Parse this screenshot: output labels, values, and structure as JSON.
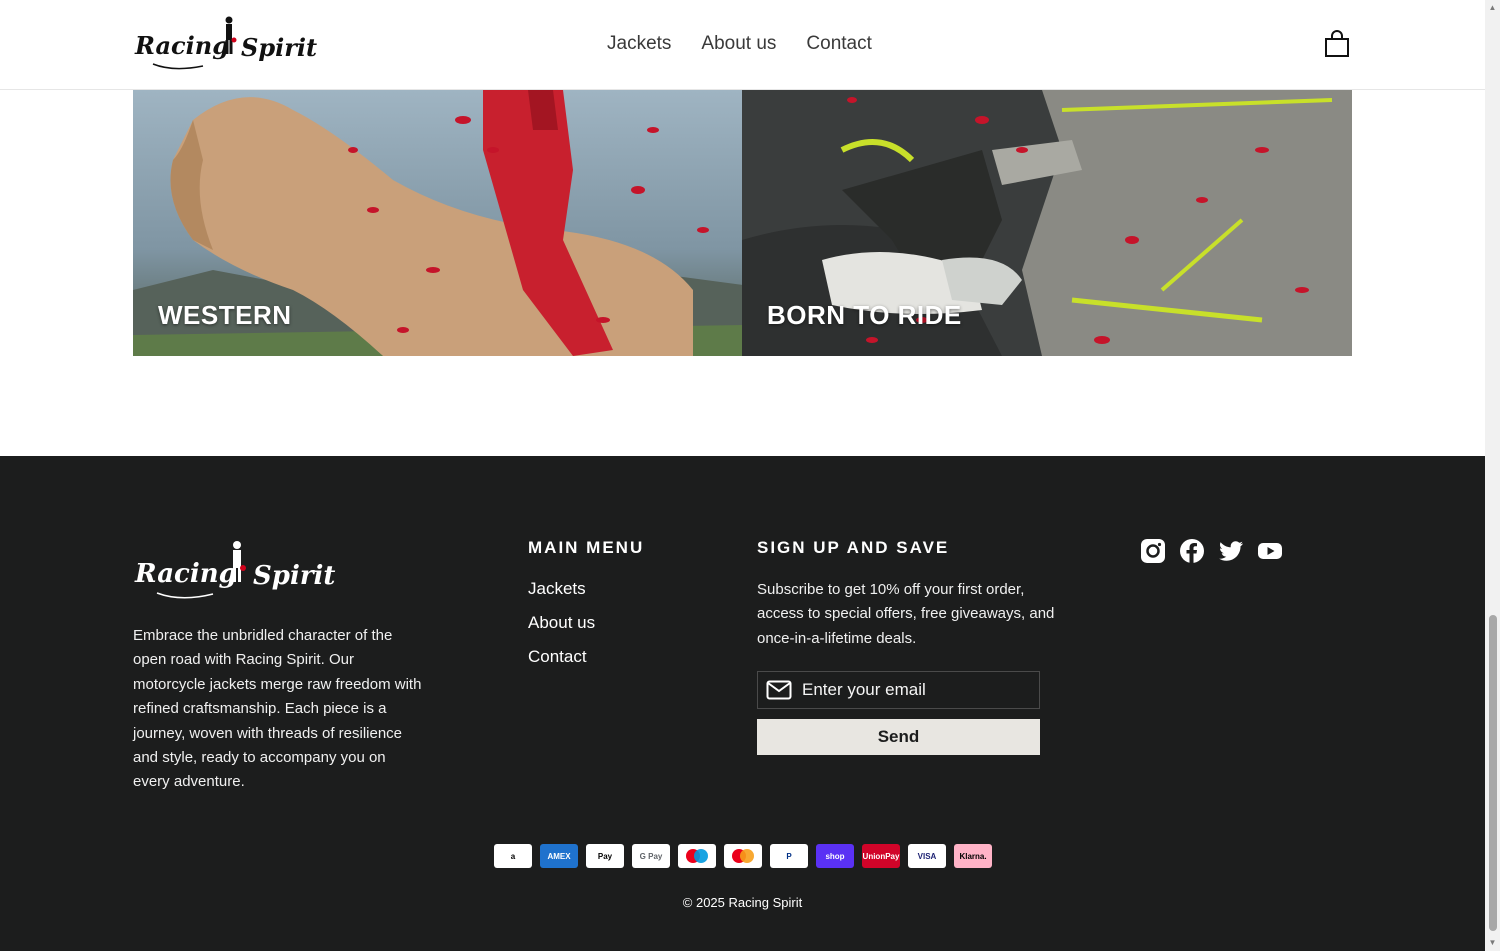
{
  "header": {
    "logo_alt": "Racing Spirit",
    "nav": [
      "Jackets",
      "About us",
      "Contact"
    ],
    "cart_icon": "shopping-bag-icon"
  },
  "collections": [
    {
      "title": "WESTERN"
    },
    {
      "title": "BORN TO RIDE"
    }
  ],
  "footer": {
    "logo_alt": "Racing Spirit",
    "description": "Embrace the unbridled character of the open road with Racing Spirit. Our motorcycle jackets merge raw freedom with refined craftsmanship. Each piece is a journey, woven with threads of resilience and style, ready to accompany you on every adventure.",
    "menu_title": "MAIN MENU",
    "menu": [
      "Jackets",
      "About us",
      "Contact"
    ],
    "signup_title": "SIGN UP AND SAVE",
    "signup_text": "Subscribe to get 10% off your first order, access to special offers, free giveaways, and once-in-a-lifetime deals.",
    "email_placeholder": "Enter your email",
    "send_label": "Send",
    "social": [
      "instagram-icon",
      "facebook-icon",
      "twitter-icon",
      "youtube-icon"
    ],
    "payments": [
      {
        "name": "amazon",
        "label": "a",
        "bg": "#ffffff",
        "fg": "#000000"
      },
      {
        "name": "american-express",
        "label": "AMEX",
        "bg": "#1f72cd",
        "fg": "#ffffff"
      },
      {
        "name": "apple-pay",
        "label": "Pay",
        "bg": "#ffffff",
        "fg": "#000000"
      },
      {
        "name": "google-pay",
        "label": "G Pay",
        "bg": "#ffffff",
        "fg": "#5f6368"
      },
      {
        "name": "maestro",
        "label": "",
        "bg": "#ffffff",
        "fg": "#000000"
      },
      {
        "name": "mastercard",
        "label": "",
        "bg": "#ffffff",
        "fg": "#000000"
      },
      {
        "name": "paypal",
        "label": "P",
        "bg": "#ffffff",
        "fg": "#003087"
      },
      {
        "name": "shop-pay",
        "label": "shop",
        "bg": "#5a31f4",
        "fg": "#ffffff"
      },
      {
        "name": "union-pay",
        "label": "UnionPay",
        "bg": "#d10429",
        "fg": "#ffffff"
      },
      {
        "name": "visa",
        "label": "VISA",
        "bg": "#ffffff",
        "fg": "#1a1f71"
      },
      {
        "name": "klarna",
        "label": "Klarna.",
        "bg": "#ffb3c7",
        "fg": "#000000"
      }
    ],
    "copyright": "© 2025 Racing Spirit"
  },
  "colors": {
    "footer_bg": "#1c1d1d",
    "send_bg": "#e8e6e1"
  }
}
